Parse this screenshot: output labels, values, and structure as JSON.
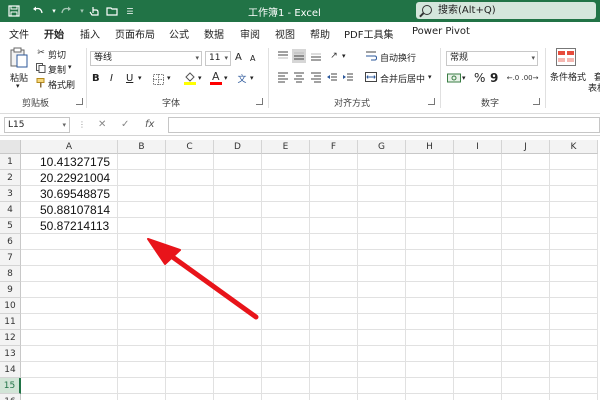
{
  "window": {
    "title": "工作簿1  -  Excel",
    "search_placeholder": "搜索(Alt+Q)"
  },
  "titlebar_icons": [
    "save-icon",
    "undo-icon",
    "redo-icon",
    "touch-mode-icon",
    "folder-icon",
    "customize-icon"
  ],
  "menu": {
    "tabs": [
      "文件",
      "开始",
      "插入",
      "页面布局",
      "公式",
      "数据",
      "审阅",
      "视图",
      "帮助",
      "PDF工具集",
      "Power Pivot"
    ],
    "active": "开始"
  },
  "ribbon": {
    "clipboard": {
      "paste": "粘贴",
      "cut": "剪切",
      "copy": "复制",
      "format_painter": "格式刷",
      "group": "剪贴板"
    },
    "font": {
      "font_name": "等线",
      "font_size": "11",
      "bold": "B",
      "italic": "I",
      "underline": "U",
      "grow": "A",
      "shrink": "A",
      "group": "字体",
      "font_color": "#ff0000",
      "fill_color": "#ffff00"
    },
    "alignment": {
      "wrap": "自动换行",
      "merge": "合并后居中",
      "group": "对齐方式"
    },
    "number": {
      "format": "常规",
      "percent": "%",
      "comma": "9",
      "group": "数字"
    },
    "styles": {
      "conditional": "条件格式",
      "table": "套",
      "table2": "表格"
    }
  },
  "formula_bar": {
    "name_box": "L15",
    "cancel": "✕",
    "enter": "✓",
    "fx": "fx",
    "value": ""
  },
  "sheet": {
    "columns": [
      "A",
      "B",
      "C",
      "D",
      "E",
      "F",
      "G",
      "H",
      "I",
      "J",
      "K"
    ],
    "rows": [
      "1",
      "2",
      "3",
      "4",
      "5",
      "6",
      "7",
      "8",
      "9",
      "10",
      "11",
      "12",
      "13",
      "14",
      "15",
      "16"
    ],
    "selected_row": "15",
    "cells": [
      {
        "ref": "A1",
        "value": "10.41327175"
      },
      {
        "ref": "A2",
        "value": "20.22921004"
      },
      {
        "ref": "A3",
        "value": "30.69548875"
      },
      {
        "ref": "A4",
        "value": "50.88107814"
      },
      {
        "ref": "A5",
        "value": "50.87214113"
      }
    ]
  },
  "annotation": {
    "arrow_color": "#e8141a"
  },
  "colors": {
    "accent": "#217346"
  }
}
